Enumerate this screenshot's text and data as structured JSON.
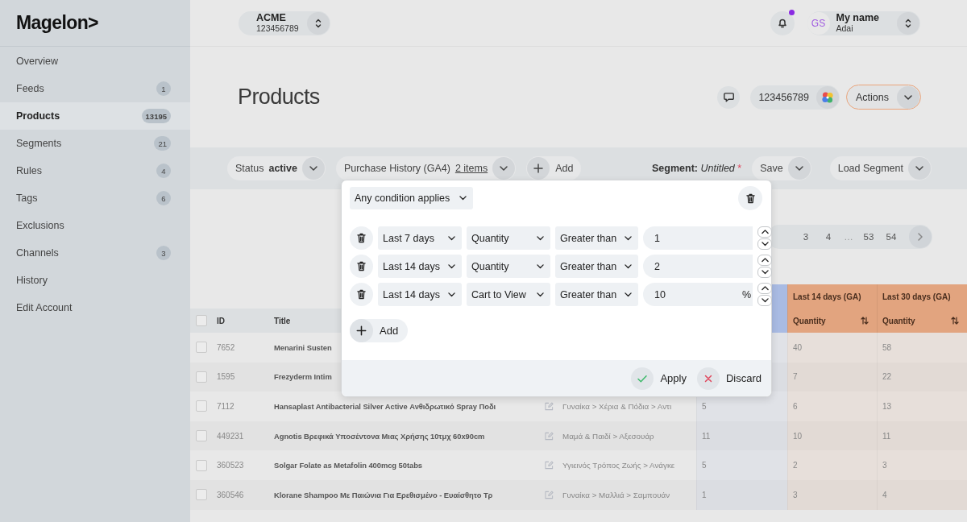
{
  "sidebar": {
    "logo": "Magelon>",
    "items": [
      {
        "label": "Overview",
        "selected": false
      },
      {
        "label": "Feeds",
        "count": "1",
        "selected": false
      },
      {
        "label": "Products",
        "count": "13195",
        "selected": true
      },
      {
        "label": "Segments",
        "count": "21",
        "selected": false
      },
      {
        "label": "Rules",
        "count": "4",
        "selected": false
      },
      {
        "label": "Tags",
        "count": "6",
        "selected": false
      },
      {
        "label": "Exclusions",
        "selected": false
      },
      {
        "label": "Channels",
        "count": "3",
        "selected": false
      },
      {
        "label": "History",
        "selected": false
      },
      {
        "label": "Edit Account",
        "selected": false
      }
    ]
  },
  "top_bar": {
    "account": {
      "name": "ACME",
      "number": "123456789"
    },
    "notifications": {
      "unread": true,
      "color": "#8a2be2"
    },
    "user": {
      "initials": "GS",
      "name": "My name",
      "subtitle": "Adai"
    }
  },
  "page_header": {
    "title": "Products",
    "feed_id": "123456789",
    "actions": "Actions"
  },
  "filter_bar": {
    "filters": [
      {
        "kind": "status",
        "label": "Status",
        "value": "active"
      },
      {
        "kind": "items",
        "label": "Purchase History (GA4)",
        "value": "2 items"
      }
    ],
    "add": "Add",
    "segment": {
      "label": "Segment:",
      "name": "Untitled",
      "mark": "*"
    },
    "save": "Save",
    "load": "Load Segment"
  },
  "pagination": {
    "pages": [
      {
        "kind": "page",
        "label": "3"
      },
      {
        "kind": "page",
        "label": "4"
      },
      {
        "kind": "gap",
        "label": "…"
      },
      {
        "kind": "page",
        "label": "53"
      },
      {
        "kind": "page",
        "label": "54"
      }
    ]
  },
  "table": {
    "header_checkbox": {
      "checked": false
    },
    "columns": [
      {
        "label": "ID"
      },
      {
        "label": "Title"
      }
    ],
    "metric_columns": [
      {
        "color": "#a9bbe3"
      },
      {
        "group": "Last 14 days (GA)",
        "label": "Quantity",
        "color": "#e2a47f",
        "sortable": true
      },
      {
        "group": "Last 30 days (GA)",
        "label": "Quantity",
        "color": "#e2a47f",
        "sortable": true
      }
    ],
    "rows": [
      {
        "checked": false,
        "id": "7652",
        "title": "Menarini Susten",
        "metrics": [
          "40",
          "58"
        ]
      },
      {
        "checked": false,
        "id": "1595",
        "title": "Frezyderm Intim",
        "metrics": [
          "7",
          "22"
        ]
      },
      {
        "checked": false,
        "id": "7112",
        "title": "Hansaplast Antibacterial Silver Active Ανθιδρωτικό Spray Ποδι",
        "category": "Γυναίκα > Χέρια & Πόδια > Αντι",
        "metrics": [
          "5",
          "6",
          "13"
        ]
      },
      {
        "checked": false,
        "id": "449231",
        "title": "Agnotis Βρεφικά Υποσέντονα Μιας Χρήσης 10τμχ 60x90cm",
        "category": "Μαμά & Παιδί > Αξεσουάρ",
        "metrics": [
          "11",
          "10",
          "11"
        ]
      },
      {
        "checked": false,
        "id": "360523",
        "title": "Solgar Folate as Metafolin 400mcg 50tabs",
        "category": "Υγιεινός Τρόπος Ζωής > Ανάγκε",
        "metrics": [
          "5",
          "2",
          "3"
        ]
      },
      {
        "checked": false,
        "id": "360546",
        "title": "Klorane Shampoo Με Παιώνια Για Ερεθισμένο - Ευαίσθητο Τρ",
        "category": "Γυναίκα > Μαλλιά > Σαμπουάν",
        "metrics": [
          "1",
          "3",
          "4"
        ]
      }
    ]
  },
  "condition_editor": {
    "match": "Any condition applies",
    "conditions": [
      {
        "period": "Last 7 days",
        "metric": "Quantity",
        "operator": "Greater than",
        "value": "1"
      },
      {
        "period": "Last 14 days",
        "metric": "Quantity",
        "operator": "Greater than",
        "value": "2"
      },
      {
        "period": "Last 14 days",
        "metric": "Cart to View",
        "operator": "Greater than",
        "value": "10",
        "unit": "%"
      }
    ],
    "add": "Add",
    "apply": "Apply",
    "discard": "Discard"
  }
}
